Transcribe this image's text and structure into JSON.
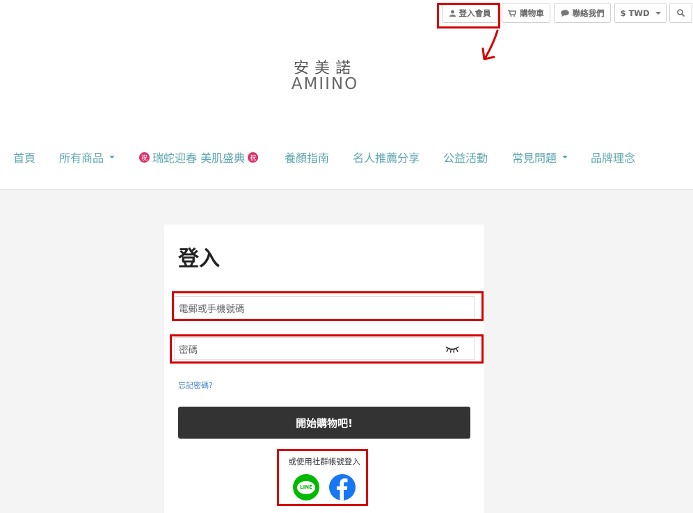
{
  "topbar": {
    "login": "登入會員",
    "cart": "購物車",
    "contact": "聯絡我們",
    "currency": "$ TWD"
  },
  "logo": {
    "cn": "安美諾",
    "en": "AMIINO"
  },
  "nav": [
    "首頁",
    "所有商品",
    "瑞蛇迎春 美肌盛典",
    "養顏指南",
    "名人推薦分享",
    "公益活動",
    "常見問題",
    "品牌理念"
  ],
  "nav_badge": "祝",
  "login": {
    "title": "登入",
    "email_placeholder": "電郵或手機號碼",
    "password_placeholder": "密碼",
    "forgot": "忘記密碼?",
    "submit": "開始購物吧!",
    "social_label": "或使用社群帳號登入",
    "line_text": "LINE"
  },
  "colors": {
    "nav": "#5ba6ad",
    "highlight": "#d40000",
    "line": "#00b900",
    "facebook": "#1877f2",
    "button": "#333333"
  }
}
